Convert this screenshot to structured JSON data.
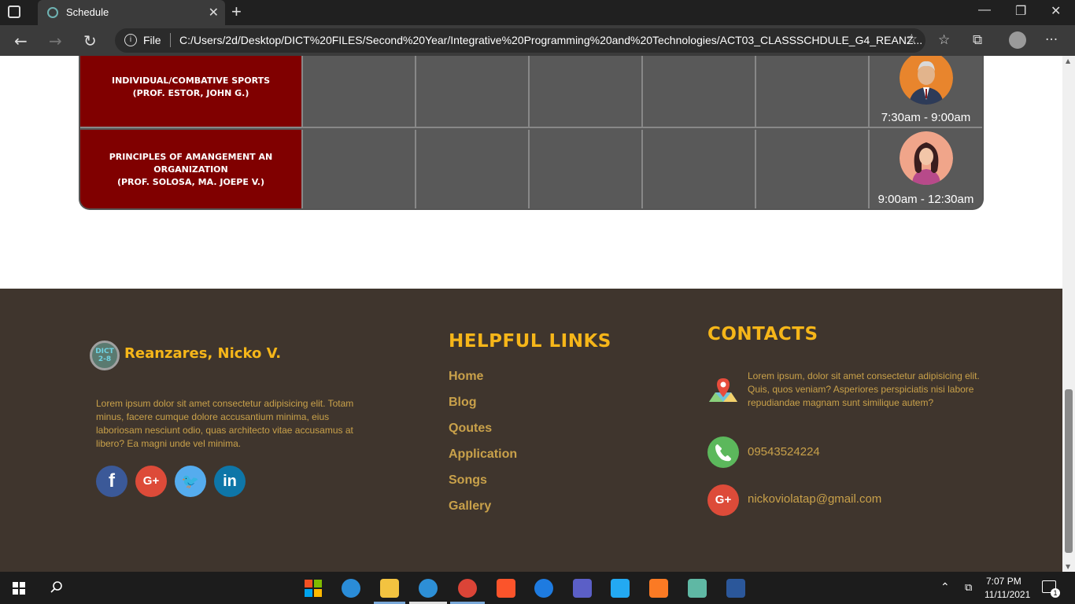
{
  "browser": {
    "tab_title": "Schedule",
    "tab_close": "✕",
    "new_tab": "+",
    "file_label": "File",
    "info": "i",
    "url": "C:/Users/2d/Desktop/DICT%20FILES/Second%20Year/Integrative%20Programming%20and%20Technologies/ACT03_CLASSSCHDULE_G4_REANZ...",
    "minimize": "—",
    "maximize": "❐",
    "close": "✕",
    "back": "←",
    "forward": "→",
    "reload": "↻",
    "favorites_add": "☆",
    "favorites": "☆",
    "collections": "⧉",
    "more": "···"
  },
  "schedule": {
    "rows": [
      {
        "subject_line1": "INDIVIDUAL/COMBATIVE SPORTS",
        "subject_line2": "(PROF. ESTOR, JOHN G.)",
        "subject_line3": "",
        "time": "7:30am - 9:00am",
        "avatar_icon": "male-professor-avatar"
      },
      {
        "subject_line1": "PRINCIPLES OF AMANGEMENT AN",
        "subject_line2": "ORGANIZATION",
        "subject_line3": "(PROF. SOLOSA, MA. JOEPE V.)",
        "time": "9:00am - 12:30am",
        "avatar_icon": "female-professor-avatar"
      }
    ]
  },
  "footer": {
    "logo_text": "DICT 2-8",
    "brand": "Reanzares, Nicko V.",
    "about": "Lorem ipsum dolor sit amet consectetur adipisicing elit. Totam minus, facere cumque dolore accusantium minima, eius laboriosam nesciunt odio, quas architecto vitae accusamus at libero? Ea magni unde vel minima.",
    "social": [
      {
        "icon": "facebook-icon",
        "glyph": "f",
        "color": "#3b5998"
      },
      {
        "icon": "google-plus-icon",
        "glyph": "G+",
        "color": "#dd4b39"
      },
      {
        "icon": "twitter-icon",
        "glyph": "🐦",
        "color": "#55acee"
      },
      {
        "icon": "linkedin-icon",
        "glyph": "in",
        "color": "#0e76a8"
      }
    ],
    "links_heading": "HELPFUL LINKS",
    "links": [
      "Home",
      "Blog",
      "Qoutes",
      "Application",
      "Songs",
      "Gallery"
    ],
    "contacts_heading": "CONTACTS",
    "address": "Lorem ipsum, dolor sit amet consectetur adipisicing elit. Quis, quos veniam? Asperiores perspiciatis nisi labore repudiandae magnam sunt similique autem?",
    "phone": "09543524224",
    "email": "nickoviolatap@gmail.com",
    "colors": {
      "background": "#3f352d",
      "accent": "#f6b619",
      "text": "#c9a14a",
      "subject_bg": "#800000"
    }
  },
  "taskbar": {
    "time": "7:07 PM",
    "date": "11/11/2021",
    "notifications": "1"
  }
}
